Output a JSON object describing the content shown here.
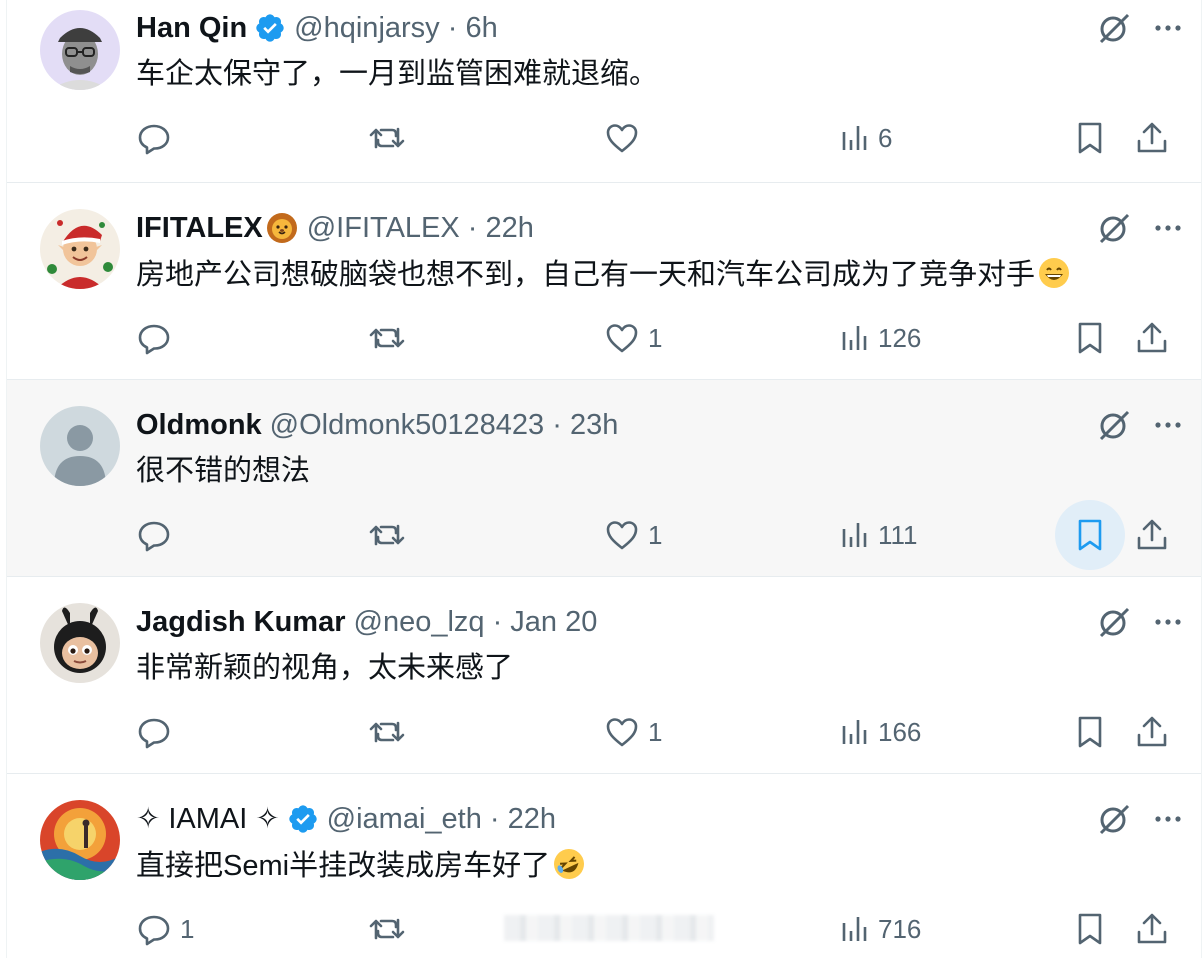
{
  "posts": [
    {
      "name": "Han Qin",
      "verified": true,
      "name_emoji": "",
      "meta": "@hqinjarsy · 6h",
      "text": "车企太保守了，一月到监管困难就退缩。",
      "text_emoji": "",
      "replies": "",
      "retweets": "",
      "likes": "",
      "views": "6",
      "bookmark_hovered": false,
      "avatar": "person-glasses-hat"
    },
    {
      "name": "IFITALEX",
      "verified": false,
      "name_emoji": "lion-emoji",
      "meta": "@IFITALEX · 22h",
      "text": "房地产公司想破脑袋也想不到，自己有一天和汽车公司成为了竞争对手",
      "text_emoji": "grinning-emoji",
      "replies": "",
      "retweets": "",
      "likes": "1",
      "views": "126",
      "bookmark_hovered": false,
      "avatar": "cartoon-elf"
    },
    {
      "name": "Oldmonk",
      "verified": false,
      "name_emoji": "",
      "meta": "@Oldmonk50128423 · 23h",
      "text": "很不错的想法",
      "text_emoji": "",
      "replies": "",
      "retweets": "",
      "likes": "1",
      "views": "111",
      "bookmark_hovered": true,
      "avatar": "default-avatar"
    },
    {
      "name": "Jagdish Kumar",
      "verified": false,
      "name_emoji": "",
      "meta": "@neo_lzq · Jan 20",
      "text": "非常新颖的视角，太未来感了",
      "text_emoji": "",
      "replies": "",
      "retweets": "",
      "likes": "1",
      "views": "166",
      "bookmark_hovered": false,
      "avatar": "labubu-toy"
    },
    {
      "name": "✧ IAMAI ✧",
      "verified": true,
      "name_emoji": "",
      "meta": "@iamai_eth · 22h",
      "text": "直接把Semi半挂改装成房车好了",
      "text_emoji": "rofl-emoji",
      "replies": "1",
      "retweets": "",
      "likes": "",
      "views": "716",
      "bookmark_hovered": false,
      "avatar": "colorful-painting"
    }
  ],
  "colors": {
    "text": "#0f1419",
    "muted": "#536471",
    "verified": "#1d9bf0",
    "hover_bg": "#f7f7f7",
    "divider": "#e7ecef"
  }
}
